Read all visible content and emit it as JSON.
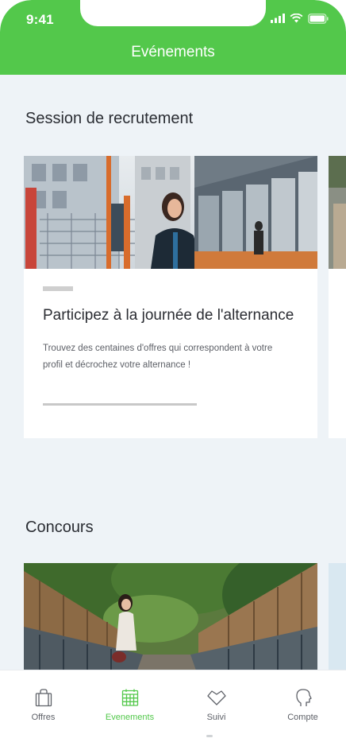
{
  "status_bar": {
    "time": "9:41"
  },
  "header": {
    "title": "Evénements"
  },
  "sections": [
    {
      "title": "Session de recrutement",
      "card": {
        "title": "Participez à la journée de l'alternance",
        "description": "Trouvez des centaines d'offres qui correspondent à votre profil et décrochez votre alternance !"
      }
    },
    {
      "title": "Concours"
    }
  ],
  "tabs": [
    {
      "label": "Offres",
      "icon": "bag-icon",
      "active": false
    },
    {
      "label": "Evenements",
      "icon": "calendar-icon",
      "active": true
    },
    {
      "label": "Suivi",
      "icon": "heart-icon",
      "active": false
    },
    {
      "label": "Compte",
      "icon": "profile-head-icon",
      "active": false
    }
  ],
  "colors": {
    "accent": "#53c84b",
    "background": "#eef3f7"
  }
}
